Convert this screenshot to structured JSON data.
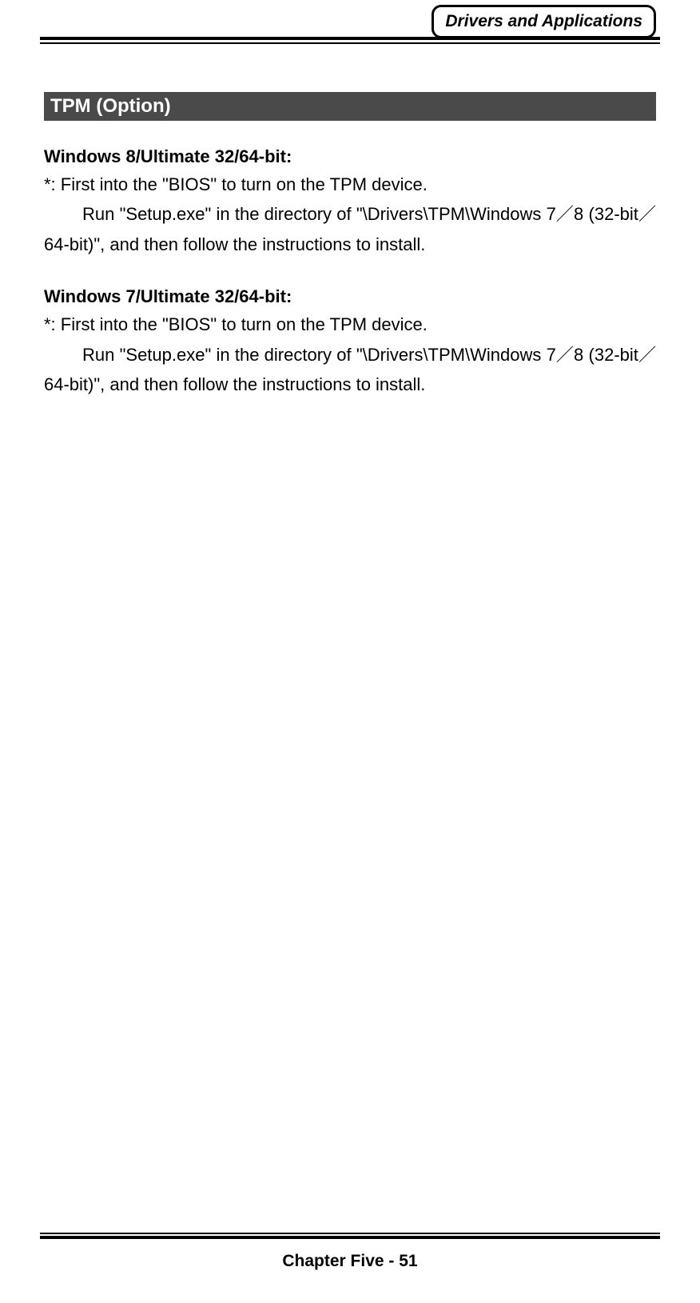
{
  "header": {
    "badge": "Drivers and Applications"
  },
  "section": {
    "title": " TPM (Option)"
  },
  "block1": {
    "heading": "Windows 8/Ultimate 32/64-bit:",
    "line1": "*: First into the \"BIOS\" to turn on the TPM device.",
    "line2": "Run \"Setup.exe\" in the directory of \"\\Drivers\\TPM\\Windows 7／8 (32-bit／64-bit)\", and then follow the instructions to install."
  },
  "block2": {
    "heading": "Windows 7/Ultimate 32/64-bit:",
    "line1": "*: First into the \"BIOS\" to turn on the TPM device.",
    "line2": "Run \"Setup.exe\" in the directory of \"\\Drivers\\TPM\\Windows 7／8 (32-bit／64-bit)\", and then follow the instructions to install."
  },
  "footer": {
    "text": "Chapter Five - 51"
  }
}
